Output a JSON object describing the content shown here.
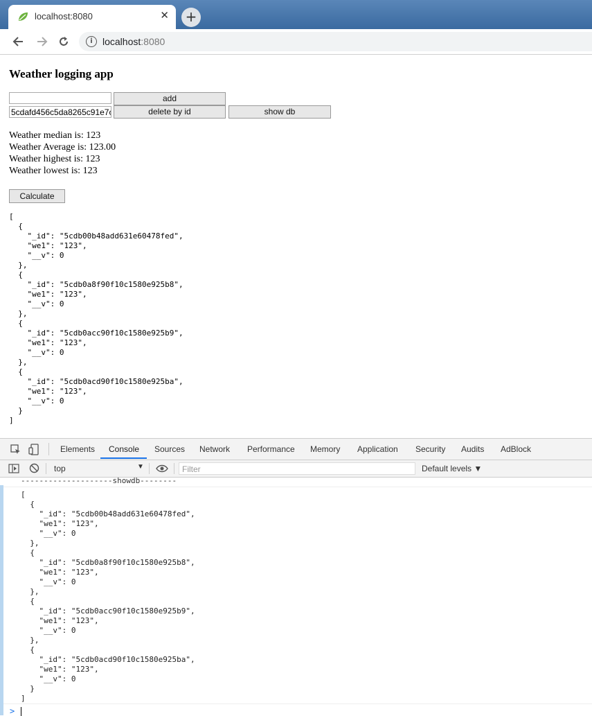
{
  "browser": {
    "tab_title": "localhost:8080",
    "close_glyph": "✕",
    "new_tab_glyph": "+",
    "url_host": "localhost",
    "url_port": ":8080"
  },
  "page": {
    "heading": "Weather logging app",
    "add_input_value": "",
    "add_button": "add",
    "delete_input_value": "5cdafd456c5da8265c91e7c",
    "delete_button": "delete by id",
    "show_db_button": "show db",
    "median": "Weather median is: 123",
    "average": "Weather Average is: 123.00",
    "highest": "Weather highest is: 123",
    "lowest": "Weather lowest is: 123",
    "calculate_button": "Calculate",
    "json_output": "[\n  {\n    \"_id\": \"5cdb00b48add631e60478fed\",\n    \"we1\": \"123\",\n    \"__v\": 0\n  },\n  {\n    \"_id\": \"5cdb0a8f90f10c1580e925b8\",\n    \"we1\": \"123\",\n    \"__v\": 0\n  },\n  {\n    \"_id\": \"5cdb0acc90f10c1580e925b9\",\n    \"we1\": \"123\",\n    \"__v\": 0\n  },\n  {\n    \"_id\": \"5cdb0acd90f10c1580e925ba\",\n    \"we1\": \"123\",\n    \"__v\": 0\n  }\n]"
  },
  "devtools": {
    "tabs": [
      "Elements",
      "Console",
      "Sources",
      "Network",
      "Performance",
      "Memory",
      "Application",
      "Security",
      "Audits",
      "AdBlock"
    ],
    "context": "top",
    "filter_placeholder": "Filter",
    "levels": "Default levels ▼",
    "separator_line": "--------------------showdb--------",
    "console_output": "[\n  {\n    \"_id\": \"5cdb00b48add631e60478fed\",\n    \"we1\": \"123\",\n    \"__v\": 0\n  },\n  {\n    \"_id\": \"5cdb0a8f90f10c1580e925b8\",\n    \"we1\": \"123\",\n    \"__v\": 0\n  },\n  {\n    \"_id\": \"5cdb0acc90f10c1580e925b9\",\n    \"we1\": \"123\",\n    \"__v\": 0\n  },\n  {\n    \"_id\": \"5cdb0acd90f10c1580e925ba\",\n    \"we1\": \"123\",\n    \"__v\": 0\n  }\n]",
    "prompt_glyph": ">"
  }
}
